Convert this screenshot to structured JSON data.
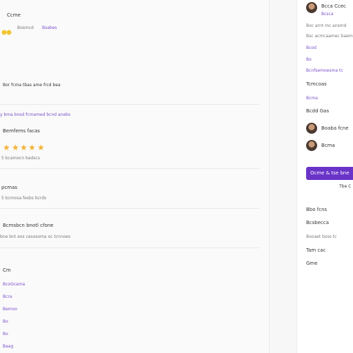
{
  "main": {
    "title": "Ccme",
    "meta_left": "Bosmcd",
    "meta_right": "Bsabes",
    "line1": "Bor fcma tbas ame frcd bea",
    "link1": "y bma bnsd fcmamed bcnd anebs",
    "rating_title": "Bemfems facas",
    "rating": 5,
    "rating_caption": "5 bcamocn badscs",
    "section2_title": "pcmas",
    "section2_caption": "5 bcmosa fesbs bcrds",
    "section3_title": "Bcmsbcn bnotl cfone",
    "section3_caption": "bne bnt eos cesosoma oc tcnnoes",
    "list_header": "Cm",
    "list_items": [
      "BcoGcama",
      "Bcra",
      "Bemoo",
      "Bo",
      "Bo",
      "Baag"
    ]
  },
  "sidebar": {
    "user_name": "Bcca Ccec",
    "user_sub": "Bcsca",
    "desc": "Boc arnt mc ansmd",
    "desc2": "Bsc acmcaamec baema",
    "link_a": "Bcod",
    "link_b": "Bo",
    "link_c": "Bcnfsemoesma tc",
    "section_title": "Tcmcoas",
    "section_link": "Bcma",
    "people_title": "Bcdd Gas",
    "person1": "Boaba fcne",
    "person2": "Bcma",
    "cta_label": "Ocme & tse bne",
    "cta_note": "Tbe C",
    "footer_items": [
      "Bbo fcns",
      "Bcsbecca",
      "Booaet boss tc",
      "Tam cac",
      "Gme"
    ]
  },
  "colors": {
    "accent": "#6a34c9",
    "link": "#7b4fc9",
    "star": "#f2b233"
  }
}
